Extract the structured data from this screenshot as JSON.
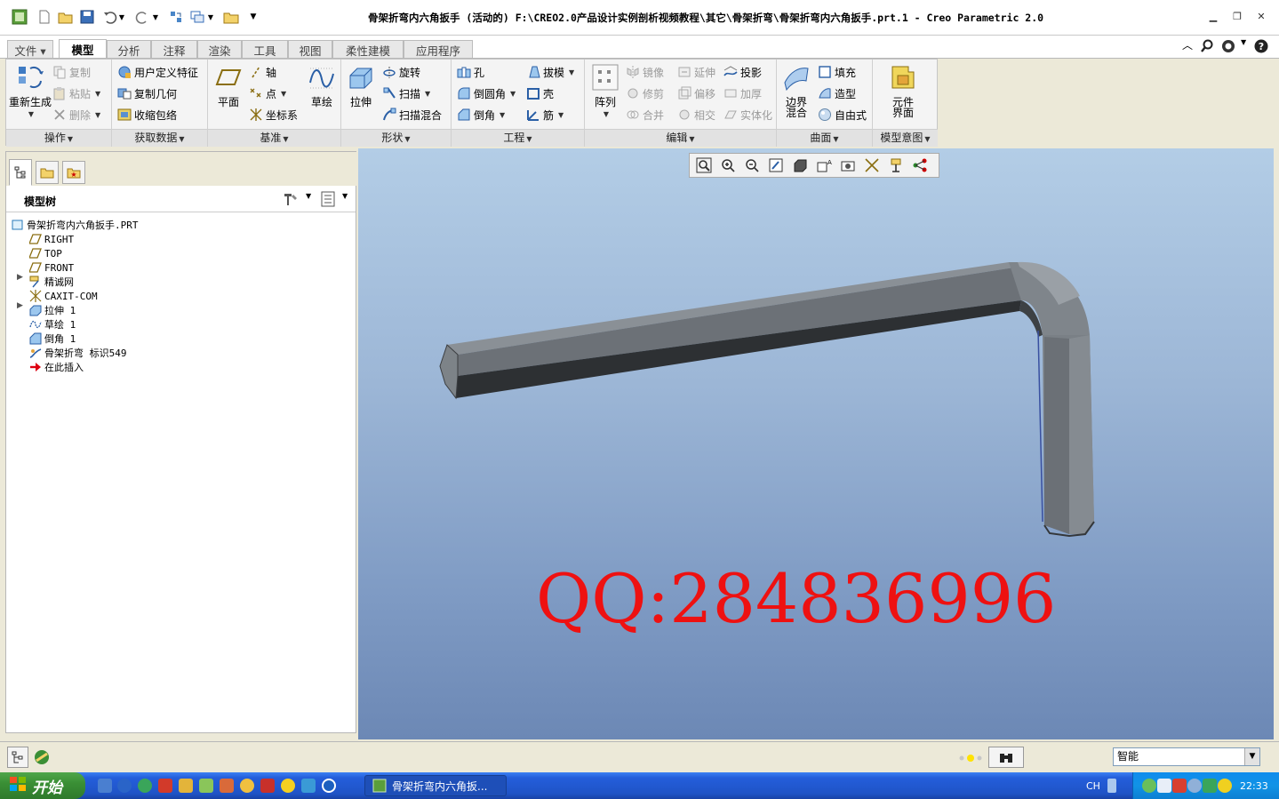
{
  "window": {
    "title": "骨架折弯内六角扳手 (活动的) F:\\CREO2.0产品设计实例剖析视频教程\\其它\\骨架折弯\\骨架折弯内六角扳手.prt.1 - Creo Parametric 2.0"
  },
  "tabs": [
    {
      "label": "文件 ▾"
    },
    {
      "label": "模型"
    },
    {
      "label": "分析"
    },
    {
      "label": "注释"
    },
    {
      "label": "渲染"
    },
    {
      "label": "工具"
    },
    {
      "label": "视图"
    },
    {
      "label": "柔性建模"
    },
    {
      "label": "应用程序"
    }
  ],
  "ribbon": {
    "operations": {
      "regen": "重新生成",
      "copy": "复制",
      "paste": "粘贴",
      "delete": "删除",
      "group": "操作"
    },
    "getdata": {
      "udf": "用户定义特征",
      "copygeom": "复制几何",
      "shrinkwrap": "收缩包络",
      "group": "获取数据"
    },
    "datum": {
      "plane": "平面",
      "axis": "轴",
      "point": "点",
      "csys": "坐标系",
      "sketch": "草绘",
      "group": "基准"
    },
    "shapes": {
      "extrude": "拉伸",
      "revolve": "旋转",
      "sweep": "扫描",
      "sweepblend": "扫描混合",
      "group": "形状"
    },
    "engineering": {
      "hole": "孔",
      "round": "倒圆角",
      "chamfer": "倒角",
      "draft": "拔模",
      "shell": "壳",
      "rib": "筋",
      "group": "工程"
    },
    "editing": {
      "pattern": "阵列",
      "mirror": "镜像",
      "trim": "修剪",
      "merge": "合并",
      "extend": "延伸",
      "offset": "偏移",
      "intersect": "相交",
      "project": "投影",
      "thicken": "加厚",
      "solidify": "实体化",
      "group": "编辑"
    },
    "surfaces": {
      "boundary": "边界混合",
      "fill": "填充",
      "style": "造型",
      "freestyle": "自由式",
      "group": "曲面"
    },
    "intent": {
      "component": "元件界面",
      "group": "模型意图"
    }
  },
  "model_tree": {
    "title": "模型树",
    "items": [
      {
        "label": "骨架折弯内六角扳手.PRT",
        "icon": "part-icon"
      },
      {
        "label": "RIGHT",
        "icon": "datum-plane-icon"
      },
      {
        "label": "TOP",
        "icon": "datum-plane-icon"
      },
      {
        "label": "FRONT",
        "icon": "datum-plane-icon"
      },
      {
        "label": "精诚网",
        "icon": "sketch-feature-icon"
      },
      {
        "label": "CAXIT-COM",
        "icon": "csys-icon"
      },
      {
        "label": "拉伸 1",
        "icon": "extrude-icon"
      },
      {
        "label": "草绘 1",
        "icon": "sketch-icon"
      },
      {
        "label": "倒角 1",
        "icon": "chamfer-icon"
      },
      {
        "label": "骨架折弯 标识549",
        "icon": "bend-icon"
      },
      {
        "label": "在此插入",
        "icon": "insert-arrow-icon"
      }
    ]
  },
  "viewport": {
    "watermark": "QQ:284836996"
  },
  "statusbar": {
    "filter": "智能"
  },
  "taskbar": {
    "start": "开始",
    "task": "骨架折弯内六角扳...",
    "lang": "CH",
    "clock": "22:33"
  },
  "colors": {
    "watermark": "#ee1111",
    "viewport_top": "#b3cde6",
    "viewport_bottom": "#6c88b5",
    "taskbar": "#245edb"
  }
}
